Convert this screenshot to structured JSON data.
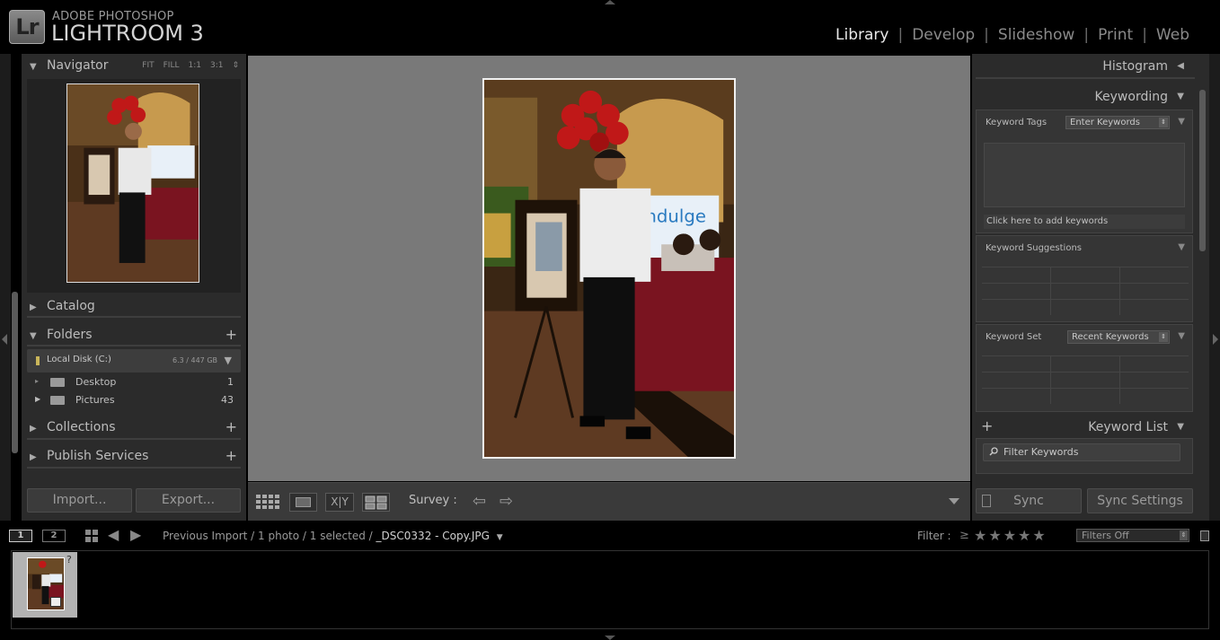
{
  "app": {
    "badge": "Lr",
    "brand_small": "ADOBE PHOTOSHOP",
    "brand_big": "LIGHTROOM 3"
  },
  "modules": [
    {
      "label": "Library",
      "active": true
    },
    {
      "label": "Develop",
      "active": false
    },
    {
      "label": "Slideshow",
      "active": false
    },
    {
      "label": "Print",
      "active": false
    },
    {
      "label": "Web",
      "active": false
    }
  ],
  "left_panel": {
    "navigator": {
      "title": "Navigator",
      "options": [
        "FIT",
        "FILL",
        "1:1",
        "3:1"
      ]
    },
    "catalog": {
      "title": "Catalog"
    },
    "folders": {
      "title": "Folders",
      "plus": "+",
      "disk": {
        "label": "Local Disk (C:)",
        "size": "6.3 / 447 GB"
      },
      "items": [
        {
          "name": "Desktop",
          "count": "1"
        },
        {
          "name": "Pictures",
          "count": "43"
        }
      ]
    },
    "collections": {
      "title": "Collections",
      "plus": "+"
    },
    "publish": {
      "title": "Publish Services",
      "plus": "+"
    },
    "import_label": "Import...",
    "export_label": "Export..."
  },
  "toolbar": {
    "survey_label": "Survey :",
    "view_icons": [
      "grid-view-icon",
      "loupe-view-icon",
      "compare-view-icon",
      "survey-view-icon"
    ]
  },
  "right_panel": {
    "histogram": {
      "title": "Histogram"
    },
    "keywording": {
      "title": "Keywording",
      "keyword_tags_label": "Keyword Tags",
      "keyword_tags_value": "Enter Keywords",
      "add_placeholder": "Click here to add keywords",
      "suggestions_label": "Keyword Suggestions",
      "set_label": "Keyword Set",
      "set_value": "Recent Keywords"
    },
    "keyword_list": {
      "title": "Keyword List",
      "plus": "+",
      "filter_placeholder": "Filter Keywords"
    },
    "sync_label": "Sync",
    "sync_settings_label": "Sync Settings"
  },
  "filmstrip_bar": {
    "page1": "1",
    "page2": "2",
    "breadcrumb_prefix": "Previous Import / 1 photo / 1 selected / ",
    "filename": "_DSC0332 - Copy.JPG",
    "filter_label": "Filter :",
    "rating_op": "≥",
    "stars": "★★★★★",
    "filters_value": "Filters Off"
  },
  "filmstrip": {
    "badge": "?"
  },
  "colors": {
    "panel_bg": "#2b2b2b",
    "center_bg": "#797979",
    "balloon": "#c01818",
    "carpet": "#7a1420"
  }
}
